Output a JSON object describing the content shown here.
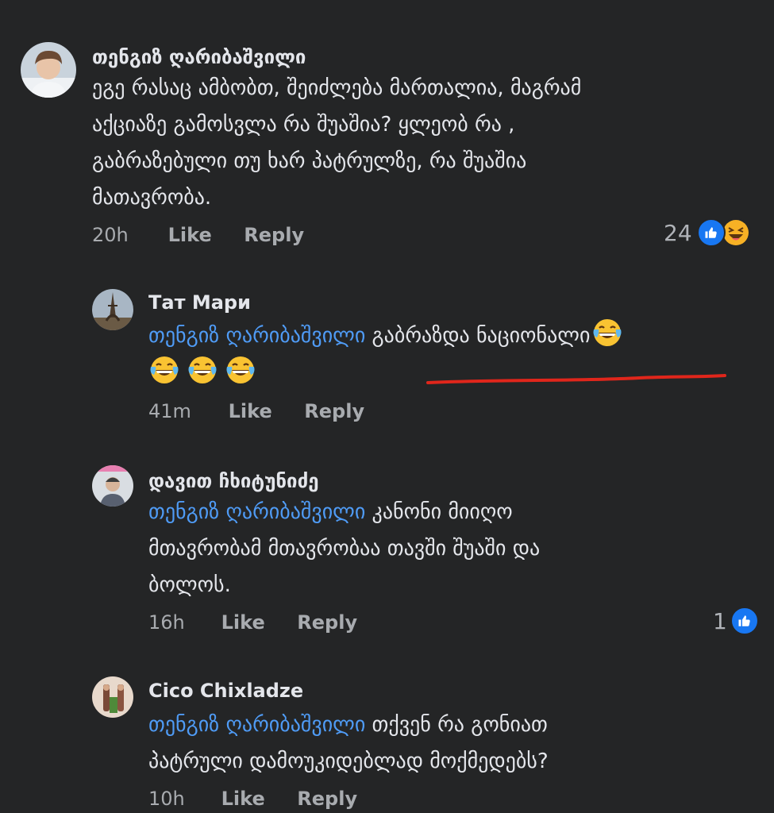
{
  "comments": [
    {
      "author": "თენგიზ ღარიბაშვილი",
      "lines": [
        "ეგე რასაც ამბობთ, შეიძლება მართალია, მაგრამ",
        "აქციაზე გამოსვლა რა შუაშია?  ყლეობ რა ,",
        "გაბრაზებული თუ ხარ პატრულზე, რა შუაშია",
        "მათავრობა."
      ],
      "time": "20h",
      "like_label": "Like",
      "reply_label": "Reply",
      "reaction_count": "24",
      "reactions": [
        "like-icon",
        "haha-icon"
      ]
    },
    {
      "author": "Тат Мари",
      "mention": "თენგიზ ღარიბაშვილი",
      "text_after_mention": " გაბრაზდა ნაციონალი",
      "emoji_trailing": [
        "laughing-crying-emoji",
        "laughing-crying-emoji",
        "laughing-crying-emoji",
        "laughing-crying-emoji"
      ],
      "time": "41m",
      "like_label": "Like",
      "reply_label": "Reply",
      "annotation_color": "#e0261b"
    },
    {
      "author": "დავით ჩხიტუნიძე",
      "mention": "თენგიზ ღარიბაშვილი",
      "line1_rest": " კანონი მიიღო",
      "lines": [
        "მთავრობამ მთავრობაა თავში შუაში და",
        "ბოლოს."
      ],
      "time": "16h",
      "like_label": "Like",
      "reply_label": "Reply",
      "reaction_count": "1",
      "reactions": [
        "like-icon"
      ]
    },
    {
      "author": "Cico Chixladze",
      "mention": "თენგიზ ღარიბაშვილი",
      "line1_rest": " თქვენ რა გონიათ",
      "lines": [
        "პატრული დამოუკიდებლად მოქმედებს?"
      ],
      "time": "10h",
      "like_label": "Like",
      "reply_label": "Reply"
    }
  ],
  "colors": {
    "background": "#242526",
    "text": "#e4e6eb",
    "meta": "#a8abaf",
    "mention": "#4f9bf5",
    "like_blue": "#1877f2"
  }
}
